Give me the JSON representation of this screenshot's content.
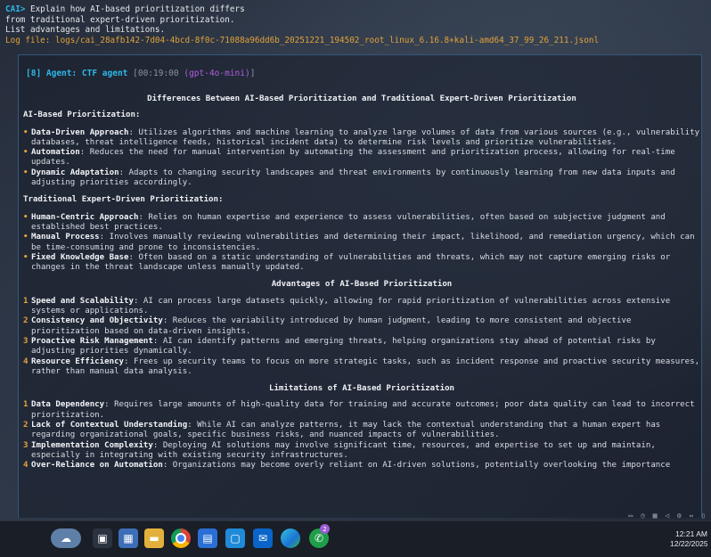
{
  "prompt": {
    "prefix": "CAI>",
    "lines": [
      " Explain how AI-based prioritization differs",
      "from traditional expert-driven prioritization.",
      "List advantages and limitations."
    ],
    "log": "Log file: logs/cai_28afb142-7d04-4bcd-8f0c-71088a96dd6b_20251221_194502_root_linux_6.16.8+kali-amd64_37_99_26_211.jsonl"
  },
  "agent": {
    "tag": "[8] Agent: CTF agent",
    "time": "[00:19:00",
    "model": "(gpt-4o-mini)",
    "close": "]"
  },
  "doc": {
    "title": "Differences Between AI-Based Prioritization and Traditional Expert-Driven Prioritization",
    "ai_heading": "AI-Based Prioritization:",
    "ai_items": [
      {
        "label": "Data-Driven Approach",
        "text": ": Utilizes algorithms and machine learning to analyze large volumes of data from various sources (e.g., vulnerability databases, threat intelligence feeds, historical incident data) to determine risk levels and prioritize vulnerabilities."
      },
      {
        "label": "Automation",
        "text": ": Reduces the need for manual intervention by automating the assessment and prioritization process, allowing for real-time updates."
      },
      {
        "label": "Dynamic Adaptation",
        "text": ": Adapts to changing security landscapes and threat environments by continuously learning from new data inputs and adjusting priorities accordingly."
      }
    ],
    "trad_heading": "Traditional Expert-Driven Prioritization:",
    "trad_items": [
      {
        "label": "Human-Centric Approach",
        "text": ": Relies on human expertise and experience to assess vulnerabilities, often based on subjective judgment and established best practices."
      },
      {
        "label": "Manual Process",
        "text": ": Involves manually reviewing vulnerabilities and determining their impact, likelihood, and remediation urgency, which can be time-consuming and prone to inconsistencies."
      },
      {
        "label": "Fixed Knowledge Base",
        "text": ": Often based on a static understanding of vulnerabilities and threats, which may not capture emerging risks or changes in the threat landscape unless manually updated."
      }
    ],
    "adv_heading": "Advantages of AI-Based Prioritization",
    "adv_items": [
      {
        "num": "1",
        "label": "Speed and Scalability",
        "text": ": AI can process large datasets quickly, allowing for rapid prioritization of vulnerabilities across extensive systems or applications."
      },
      {
        "num": "2",
        "label": "Consistency and Objectivity",
        "text": ": Reduces the variability introduced by human judgment, leading to more consistent and objective prioritization based on data-driven insights."
      },
      {
        "num": "3",
        "label": "Proactive Risk Management",
        "text": ": AI can identify patterns and emerging threats, helping organizations stay ahead of potential risks by adjusting priorities dynamically."
      },
      {
        "num": "4",
        "label": "Resource Efficiency",
        "text": ": Frees up security teams to focus on more strategic tasks, such as incident response and proactive security measures, rather than manual data analysis."
      }
    ],
    "lim_heading": "Limitations of AI-Based Prioritization",
    "lim_items": [
      {
        "num": "1",
        "label": "Data Dependency",
        "text": ": Requires large amounts of high-quality data for training and accurate outcomes; poor data quality can lead to incorrect prioritization."
      },
      {
        "num": "2",
        "label": "Lack of Contextual Understanding",
        "text": ": While AI can analyze patterns, it may lack the contextual understanding that a human expert has regarding organizational goals, specific business risks, and nuanced impacts of vulnerabilities."
      },
      {
        "num": "3",
        "label": "Implementation Complexity",
        "text": ": Deploying AI solutions may involve significant time, resources, and expertise to set up and maintain, especially in integrating with existing security infrastructures."
      },
      {
        "num": "4",
        "label": "Over-Reliance on Automation",
        "text": ": Organizations may become overly reliant on AI-driven solutions, potentially overlooking the importance"
      }
    ]
  },
  "taskbar": {
    "clock_time": "12:21 AM",
    "clock_date": "12/22/2025",
    "badge_count": "2",
    "apps": [
      "weather-widget-icon",
      "task-view-icon",
      "calendar-icon",
      "file-explorer-icon",
      "chrome-icon",
      "app-icon",
      "vscode-icon",
      "outlook-icon",
      "edge-icon",
      "whatsapp-icon"
    ]
  }
}
